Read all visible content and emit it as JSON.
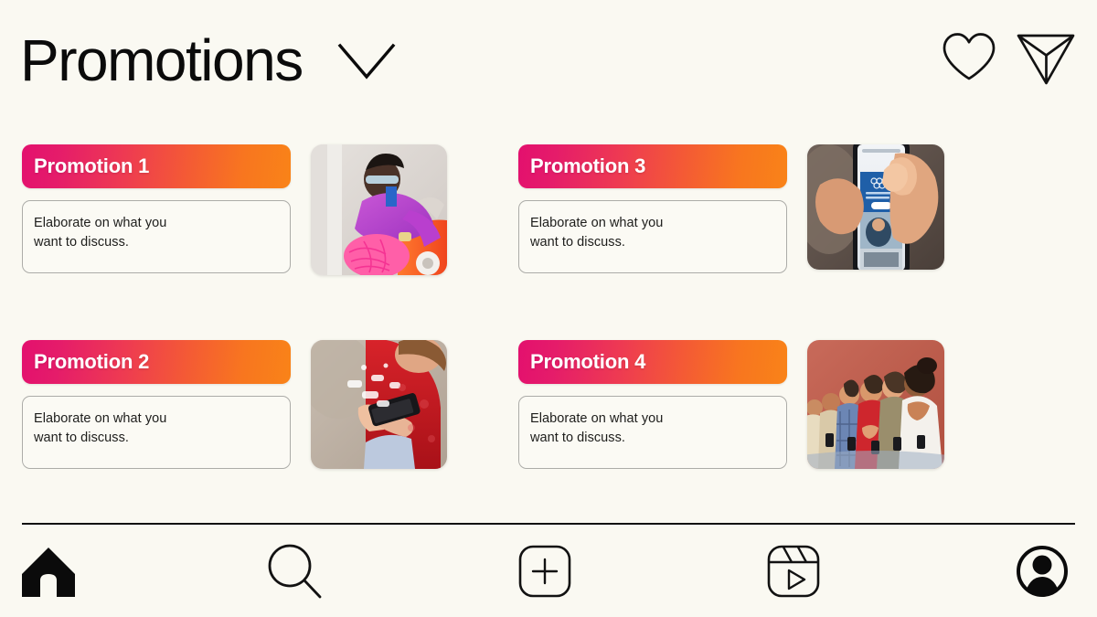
{
  "header": {
    "title": "Promotions",
    "dropdown_icon": "chevron-down-icon",
    "actions": [
      {
        "name": "heart-icon",
        "label": "Likes"
      },
      {
        "name": "send-icon",
        "label": "Share"
      }
    ]
  },
  "theme": {
    "background": "#FAF9F2",
    "text": "#0B0B0B",
    "banner_gradient_start": "#E3106E",
    "banner_gradient_end": "#F98318",
    "card_border": "#ACACA8",
    "divider": "#111111"
  },
  "cards": [
    {
      "title": "Promotion 1",
      "body": "Elaborate on what you\nwant to discuss.",
      "image_alt": "Person in purple jacket with pink bag posing against wall"
    },
    {
      "title": "Promotion 2",
      "body": "Elaborate on what you\nwant to discuss.",
      "image_alt": "Smiling woman in red sweater holding a smartphone"
    },
    {
      "title": "Promotion 3",
      "body": "Elaborate on what you\nwant to discuss.",
      "image_alt": "Hands holding a phone showing an app screen"
    },
    {
      "title": "Promotion 4",
      "body": "Elaborate on what you\nwant to discuss.",
      "image_alt": "Group of friends with phones against a red wall"
    }
  ],
  "bottom_nav": [
    {
      "name": "home-icon",
      "label": "Home",
      "active": true
    },
    {
      "name": "search-icon",
      "label": "Search",
      "active": false
    },
    {
      "name": "create-icon",
      "label": "Create",
      "active": false
    },
    {
      "name": "reels-icon",
      "label": "Reels",
      "active": false
    },
    {
      "name": "profile-icon",
      "label": "Profile",
      "active": false
    }
  ]
}
